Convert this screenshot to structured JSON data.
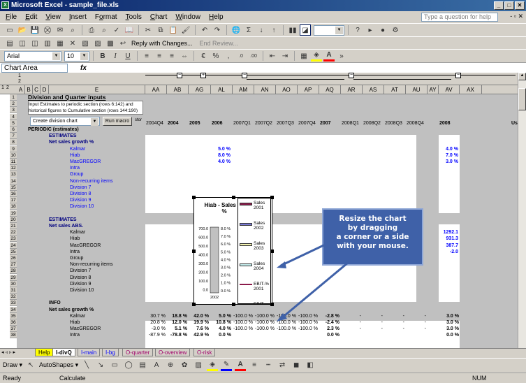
{
  "window": {
    "title": "Microsoft Excel - sample_file.xls",
    "min": "_",
    "max": "□",
    "close": "✕"
  },
  "menu": {
    "items": [
      {
        "label": "File",
        "u": "F",
        "rest": "ile"
      },
      {
        "label": "Edit",
        "u": "E",
        "rest": "dit"
      },
      {
        "label": "View",
        "u": "V",
        "rest": "iew"
      },
      {
        "label": "Insert",
        "u": "I",
        "rest": "nsert"
      },
      {
        "label": "Format",
        "u": "o",
        "pre": "F",
        "rest": "rmat"
      },
      {
        "label": "Tools",
        "u": "T",
        "rest": "ools"
      },
      {
        "label": "Chart",
        "u": "C",
        "rest": "hart"
      },
      {
        "label": "Window",
        "u": "W",
        "rest": "indow"
      },
      {
        "label": "Help",
        "u": "H",
        "rest": "elp"
      }
    ],
    "help_placeholder": "Type a question for help"
  },
  "review_toolbar": {
    "reply": "Reply with Changes...",
    "end": "End Review..."
  },
  "format_toolbar": {
    "font": "Arial",
    "size": "10",
    "bold": "B",
    "italic": "I",
    "underline": "U",
    "percent": "%",
    "comma": ",",
    "dec_inc": ".0",
    "dec_dec": ".00"
  },
  "formula_bar": {
    "name_box": "Chart Area",
    "fx": "fx"
  },
  "outline_levels": {
    "col": [
      "1",
      "2"
    ],
    "row": [
      "1",
      "2"
    ]
  },
  "columns": [
    "A",
    "B",
    "C",
    "D",
    "E",
    "AA",
    "AB",
    "AG",
    "AL",
    "AM",
    "AN",
    "AO",
    "AP",
    "AQ",
    "AR",
    "AS",
    "AT",
    "AU",
    "AY",
    "AV",
    "AX"
  ],
  "period_row": [
    "2004Q4",
    "2004",
    "2005",
    "2006",
    "2007Q1",
    "2007Q2",
    "2007Q3",
    "2007Q4",
    "2007",
    "2008Q1",
    "2008Q2",
    "2008Q3",
    "2008Q4",
    "2008"
  ],
  "period_suffix": "Us",
  "header_info": {
    "title": "Division and Quarter inputs",
    "line1": "Input Estimates to periodic section (rows 6:142) and",
    "line2": "historical figures to Cumulative section (rows 144:190)",
    "dropdown": "Create division chart",
    "button": "Run macro",
    "overflow": "stor"
  },
  "sections": {
    "periodic": "PERIODIC (estimates)",
    "estimates": "ESTIMATES",
    "growth": "Net sales growth %",
    "estimates2": "ESTIMATES",
    "abs": "Net sales ABS.",
    "info": "INFO",
    "growth2": "Net sales growth %"
  },
  "divisions": [
    "Kalmar",
    "Hiab",
    "MacGREGOR",
    "Intra",
    "Group",
    "Non-recurring items",
    "Division 7",
    "Division 8",
    "Division 9",
    "Division 10"
  ],
  "div_block1_extra": "Division 10",
  "values": {
    "growth_AL": [
      "5.0 %",
      "8.0 %",
      "4.0 %"
    ],
    "growth_AQ_top": "4.0",
    "growth_AY": [
      "4.0 %",
      "7.0 %",
      "3.0 %"
    ],
    "abs_AQ": [
      "1254.4",
      "904.2",
      "376.4",
      "-2.0"
    ],
    "abs_AY": [
      "1292.1",
      "931.3",
      "387.7",
      "-2.0"
    ],
    "info_rows": [
      {
        "AA": "30.7 %",
        "AB": "18.8 %",
        "AG": "42.0 %",
        "AL": "5.0 %",
        "AM": "-100.0 %",
        "AN": "-100.0 %",
        "AO": "-100.0 %",
        "AP": "-100.0 %",
        "AQ": "-2.8 %",
        "AR": "-",
        "AS": "-",
        "AT": "-",
        "AU": "-",
        "AY": "3.0 %"
      },
      {
        "AA": "20.8 %",
        "AB": "12.0 %",
        "AG": "19.9 %",
        "AL": "10.8 %",
        "AM": "-100.0 %",
        "AN": "-100.0 %",
        "AO": "-100.0 %",
        "AP": "-100.0 %",
        "AQ": "-2.4 %",
        "AR": "-",
        "AS": "-",
        "AT": "-",
        "AU": "-",
        "AY": "3.0 %"
      },
      {
        "AA": "-3.0 %",
        "AB": "5.1 %",
        "AG": "7.6 %",
        "AL": "4.0 %",
        "AM": "-100.0 %",
        "AN": "-100.0 %",
        "AO": "-100.0 %",
        "AP": "-100.0 %",
        "AQ": "2.3 %",
        "AR": "-",
        "AS": "-",
        "AT": "-",
        "AU": "-",
        "AY": "3.0 %"
      },
      {
        "AA": "-87.9 %",
        "AB": "-78.8 %",
        "AG": "42.9 %",
        "AL": "0.0 %",
        "AM": "",
        "AN": "",
        "AO": "",
        "AP": "",
        "AQ": "0.0 %",
        "AR": "",
        "AS": "",
        "AT": "",
        "AU": "",
        "AY": "0.0 %"
      }
    ]
  },
  "row_numbers": [
    "1",
    "2",
    "3",
    "4",
    "5",
    "6",
    "7",
    "8",
    "9",
    "10",
    "11",
    "12",
    "13",
    "14",
    "15",
    "16",
    "17",
    "18",
    "19",
    "20",
    "21",
    "22",
    "23",
    "24",
    "25",
    "26",
    "27",
    "28",
    "29",
    "30",
    "31",
    "32",
    "33",
    "34",
    "35",
    "36",
    "37",
    "38"
  ],
  "callout": {
    "line1": "Resize the chart",
    "line2": "by dragging",
    "line3": "a corner or a side",
    "line4": "with your mouse."
  },
  "chart": {
    "title": "Hiab - Sales an %",
    "title_a": "Hiab - Sales an",
    "title_b": "%",
    "left_axis": [
      "700.0",
      "600.0",
      "500.0",
      "400.0",
      "300.0",
      "200.0",
      "100.0",
      "0.0"
    ],
    "right_axis": [
      "8.0 %",
      "7.0 %",
      "6.0 %",
      "5.0 %",
      "4.0 %",
      "3.0 %",
      "2.0 %",
      "1.0 %",
      "0.0 %"
    ],
    "x_label": "2002",
    "legend": [
      {
        "name": "Sales 2001",
        "color": "#8b1a4a"
      },
      {
        "name": "Sales 2002",
        "color": "#7b7bd6"
      },
      {
        "name": "Sales 2003",
        "color": "#f2f2b0"
      },
      {
        "name": "Sales 2004",
        "color": "#c8f0f0"
      },
      {
        "name": "EBIT-% 2001",
        "color": "#8b1a4a"
      },
      {
        "name": "EBIT-",
        "color": "#7b7bd6"
      }
    ]
  },
  "sheet_tabs": [
    "Help",
    "I-divQ",
    "I-main",
    "I-bg",
    "O-quarter",
    "O-overview",
    "O-risk"
  ],
  "draw_toolbar": {
    "draw": "Draw ▾",
    "autoshapes": "AutoShapes ▾"
  },
  "status": {
    "left": "Ready",
    "middle": "Calculate",
    "num": "NUM"
  }
}
